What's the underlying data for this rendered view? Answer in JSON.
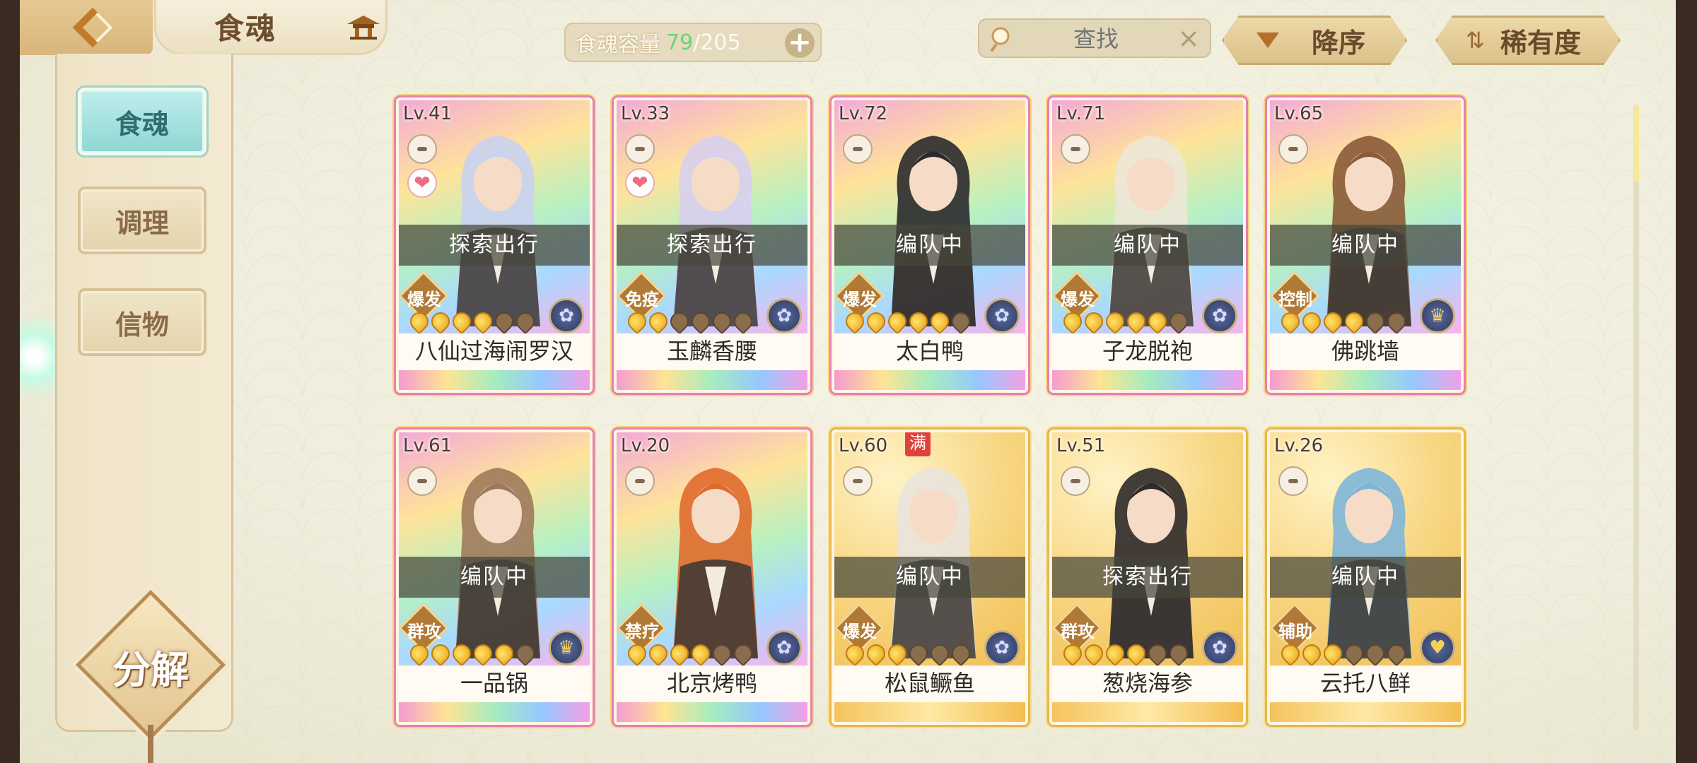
{
  "topbar": {
    "title": "食魂",
    "capacity_label": "食魂容量",
    "capacity_current": "79",
    "capacity_slash": "/",
    "capacity_max": "205",
    "capacity_add": "+",
    "search_placeholder": "查找",
    "search_clear": "×",
    "sort_label": "降序",
    "rarity_label": "稀有度",
    "rarity_icon": "⇅"
  },
  "sidebar": {
    "tabs": [
      {
        "label": "食魂",
        "active": true
      },
      {
        "label": "调理",
        "active": false
      },
      {
        "label": "信物",
        "active": false
      }
    ],
    "decompose_label": "分解"
  },
  "cards": [
    {
      "level": "Lv.41",
      "status": "探索出行",
      "type": "爆发",
      "name": "八仙过海闹罗汉",
      "stars_filled": 4,
      "stars_total": 6,
      "heart": true,
      "rarity": "rainbow",
      "hair": "#c9d2f2",
      "element_icon": "flower-icon"
    },
    {
      "level": "Lv.33",
      "status": "探索出行",
      "type": "免疫",
      "name": "玉麟香腰",
      "stars_filled": 2,
      "stars_total": 6,
      "heart": true,
      "rarity": "rainbow",
      "hair": "#d7cff0",
      "element_icon": "flower-icon"
    },
    {
      "level": "Lv.72",
      "status": "编队中",
      "type": "爆发",
      "name": "太白鸭",
      "stars_filled": 5,
      "stars_total": 6,
      "heart": false,
      "rarity": "rainbow",
      "hair": "#2a2a2e",
      "element_icon": "flower-icon"
    },
    {
      "level": "Lv.71",
      "status": "编队中",
      "type": "爆发",
      "name": "子龙脱袍",
      "stars_filled": 5,
      "stars_total": 6,
      "heart": false,
      "rarity": "rainbow",
      "hair": "#ece7d8",
      "element_icon": "flower-icon"
    },
    {
      "level": "Lv.65",
      "status": "编队中",
      "type": "控制",
      "name": "佛跳墙",
      "stars_filled": 4,
      "stars_total": 6,
      "heart": false,
      "rarity": "rainbow",
      "hair": "#8b5a38",
      "element_icon": "lamp-icon"
    },
    {
      "level": "Lv.61",
      "status": "编队中",
      "type": "群攻",
      "name": "一品锅",
      "stars_filled": 5,
      "stars_total": 6,
      "heart": false,
      "rarity": "rainbow",
      "hair": "#9e7a5c",
      "element_icon": "lamp-icon"
    },
    {
      "level": "Lv.20",
      "status": "",
      "type": "禁疗",
      "name": "北京烤鸭",
      "stars_filled": 4,
      "stars_total": 6,
      "heart": false,
      "rarity": "rainbow",
      "hair": "#e06a2c",
      "element_icon": "flower-icon"
    },
    {
      "level": "Lv.60",
      "status": "编队中",
      "type": "爆发",
      "name": "松鼠鳜鱼",
      "stars_filled": 3,
      "stars_total": 6,
      "heart": false,
      "rarity": "gold",
      "full_badge": "满",
      "hair": "#e9e4de",
      "element_icon": "flower-icon"
    },
    {
      "level": "Lv.51",
      "status": "探索出行",
      "type": "群攻",
      "name": "葱烧海参",
      "stars_filled": 4,
      "stars_total": 6,
      "heart": false,
      "rarity": "gold",
      "hair": "#2e2a2a",
      "element_icon": "flower-icon"
    },
    {
      "level": "Lv.26",
      "status": "编队中",
      "type": "辅助",
      "name": "云托八鲜",
      "stars_filled": 3,
      "stars_total": 6,
      "heart": false,
      "rarity": "gold",
      "hair": "#7fb6d8",
      "element_icon": "heart-icon"
    }
  ]
}
